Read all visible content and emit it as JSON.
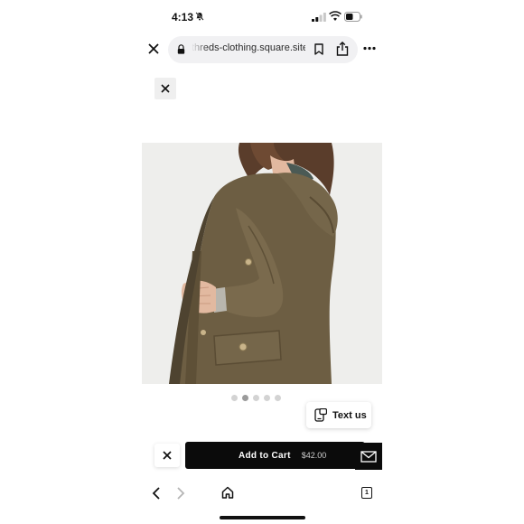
{
  "status_bar": {
    "time": "4:13"
  },
  "browser": {
    "url": "threds-clothing.square.site",
    "tab_count": "1"
  },
  "carousel": {
    "count": 5,
    "active_index": 1
  },
  "text_us": {
    "label": "Text us"
  },
  "cart": {
    "label": "Add to Cart",
    "price": "$42.00"
  },
  "icons": [
    "bell-slash-icon",
    "signal-icon",
    "wifi-icon",
    "battery-icon",
    "close-icon",
    "lock-icon",
    "bookmark-icon",
    "share-icon",
    "more-icon",
    "chat-icon",
    "mail-icon",
    "back-icon",
    "forward-icon",
    "home-icon",
    "tabs-icon"
  ],
  "colors": {
    "button_bg": "#0b0b0b",
    "jacket": "#6e5f44",
    "url_bar": "#f1f1f3"
  }
}
